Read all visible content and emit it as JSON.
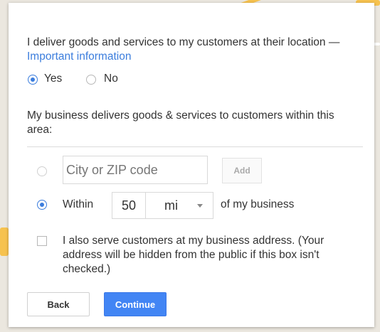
{
  "service_question": {
    "text": "I deliver goods and services to my customers at their location — ",
    "link": "Important information",
    "options": [
      "Yes",
      "No"
    ],
    "selected": "Yes"
  },
  "service_area": {
    "description": "My business delivers goods & services to customers within this area:",
    "city_zip_placeholder": "City or ZIP code",
    "add_label": "Add",
    "within_label": "Within",
    "radius_value": "50",
    "unit_value": "mi",
    "suffix": "of my business",
    "selected_option": "within"
  },
  "address_checkbox": {
    "label": "I also serve customers at my business address. (Your address will be hidden from the public if this box isn't checked.)",
    "checked": false
  },
  "buttons": {
    "back": "Back",
    "continue": "Continue"
  },
  "colors": {
    "accent": "#4285f4",
    "link": "#3b7ddd",
    "map_road": "#f6c24f"
  }
}
